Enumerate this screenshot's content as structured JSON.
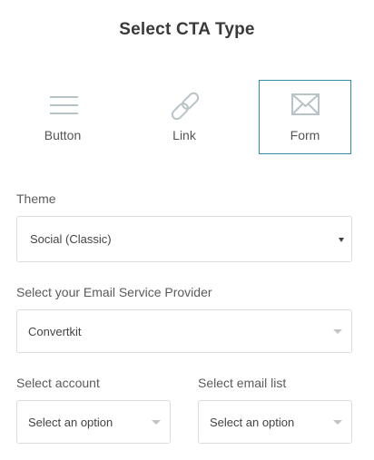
{
  "title": "Select CTA Type",
  "cta_types": [
    {
      "label": "Button",
      "icon": "menu-lines-icon",
      "selected": false
    },
    {
      "label": "Link",
      "icon": "link-icon",
      "selected": false
    },
    {
      "label": "Form",
      "icon": "envelope-icon",
      "selected": true
    }
  ],
  "theme": {
    "label": "Theme",
    "value": "Social (Classic)"
  },
  "esp": {
    "label": "Select your Email Service Provider",
    "value": "Convertkit"
  },
  "account": {
    "label": "Select account",
    "value": "Select an option"
  },
  "email_list": {
    "label": "Select email list",
    "value": "Select an option"
  },
  "colors": {
    "accent": "#2f8ea3",
    "icon": "#b8c3c7"
  }
}
